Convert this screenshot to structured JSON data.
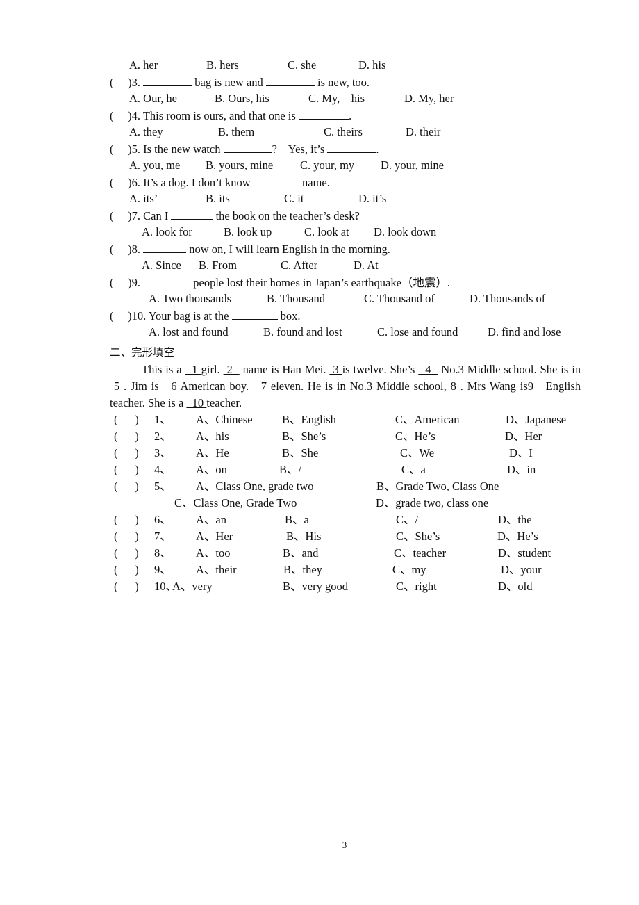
{
  "part1": {
    "q2_options": [
      "A. her",
      "B. hers",
      "C. she",
      "D. his"
    ],
    "questions": [
      {
        "num": "3.",
        "text_parts": [
          "",
          " bag is new and ",
          " is new, too."
        ],
        "options": [
          "A. Our, he",
          "B. Ours, his",
          "C. My,    his",
          "D. My, her"
        ]
      },
      {
        "num": "4.",
        "text_parts": [
          "This room is ours, and that one is ",
          "."
        ],
        "options": [
          "A. they",
          "B. them",
          "C. theirs",
          "D. their"
        ]
      },
      {
        "num": "5.",
        "text_parts": [
          "Is the new watch ",
          "?    Yes, it’s ",
          "."
        ],
        "options": [
          "A. you, me",
          "B. yours, mine",
          "C. your, my",
          "D. your, mine"
        ]
      },
      {
        "num": "6.",
        "text_parts": [
          "It’s a dog. I don’t know ",
          " name."
        ],
        "options": [
          "A. its’",
          "B. its",
          "C. it",
          "D. it’s"
        ]
      },
      {
        "num": "7.",
        "text_parts": [
          "Can I ",
          " the book on the teacher’s desk?"
        ],
        "options": [
          "A. look for",
          "B. look up",
          "C. look at",
          "D. look down"
        ]
      },
      {
        "num": "8.",
        "text_parts": [
          "",
          " now on, I will learn English in the morning."
        ],
        "options": [
          "A. Since",
          "B. From",
          "C. After",
          "D. At"
        ]
      },
      {
        "num": "9.",
        "text_parts": [
          "",
          " people lost their homes in Japan’s earthquake（地震）."
        ],
        "options": [
          "A. Two thousands",
          "B. Thousand",
          "C. Thousand of",
          "D. Thousands of"
        ]
      },
      {
        "num": "10.",
        "text_parts": [
          "Your bag is at the ",
          " box."
        ],
        "options": [
          "A. lost and found",
          "B. found and lost",
          "C. lose and found",
          "D. find and lose"
        ]
      }
    ]
  },
  "part2": {
    "title": "二、完形填空",
    "passage": [
      {
        "t": "This is a "
      },
      {
        "u": "  1 "
      },
      {
        "t": "girl. "
      },
      {
        "u": " 2  "
      },
      {
        "t": " name is Han Mei. "
      },
      {
        "u": " 3 "
      },
      {
        "t": "is twelve. She’s "
      },
      {
        "u": "  4  "
      },
      {
        "t": " No.3 Middle school. She is in "
      },
      {
        "u": " 5 "
      },
      {
        "t": ". Jim is "
      },
      {
        "u": "  6 "
      },
      {
        "t": "American boy. "
      },
      {
        "u": "  7 "
      },
      {
        "t": "eleven. He is in No.3 Middle school, "
      },
      {
        "u": "8 "
      },
      {
        "t": ". Mrs Wang is"
      },
      {
        "u": "9  "
      },
      {
        "t": " English teacher. She is a  "
      },
      {
        "u": "  10 "
      },
      {
        "t": "teacher."
      }
    ],
    "paren": "(　　)",
    "questions": [
      {
        "num": "1、",
        "options": [
          "A、Chinese",
          "B、English",
          "C、American",
          "D、Japanese"
        ]
      },
      {
        "num": "2、",
        "options": [
          "A、his",
          "B、She’s",
          "C、He’s",
          "D、Her"
        ]
      },
      {
        "num": "3、",
        "options": [
          "A、He",
          "B、She",
          "C、We",
          "D、I"
        ]
      },
      {
        "num": "4、",
        "options": [
          "A、on",
          "B、/",
          "C、a",
          "D、in"
        ]
      },
      {
        "num": "5、",
        "options": [
          "A、Class One, grade two",
          "B、Grade Two, Class One",
          "C、Class One, Grade Two",
          "D、grade two, class one"
        ]
      },
      {
        "num": "6、",
        "options": [
          "A、an",
          "B、a",
          "C、/",
          "D、the"
        ]
      },
      {
        "num": "7、",
        "options": [
          "A、Her",
          "B、His",
          "C、She’s",
          "D、He’s"
        ]
      },
      {
        "num": "8、",
        "options": [
          "A、too",
          "B、and",
          "C、teacher",
          "D、student"
        ]
      },
      {
        "num": "9、",
        "options": [
          "A、their",
          "B、they",
          "C、my",
          "D、your"
        ]
      },
      {
        "num": "10、",
        "options": [
          "A、very",
          "B、very good",
          "C、right",
          "D、old"
        ]
      }
    ]
  },
  "page_number": "3"
}
